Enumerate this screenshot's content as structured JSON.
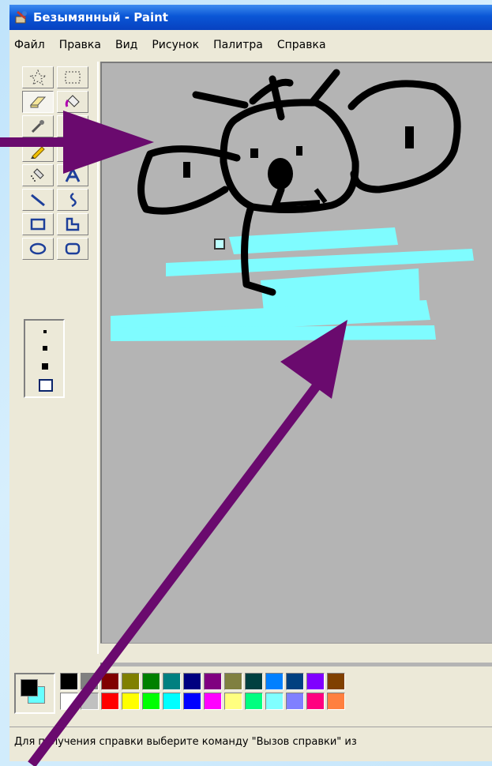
{
  "window": {
    "title": "Безымянный - Paint"
  },
  "menu": {
    "items": [
      "Файл",
      "Правка",
      "Вид",
      "Рисунок",
      "Палитра",
      "Справка"
    ]
  },
  "toolbox": {
    "tools": [
      {
        "name": "free-select",
        "icon": "star-select-icon"
      },
      {
        "name": "select",
        "icon": "rect-select-icon"
      },
      {
        "name": "eraser",
        "icon": "eraser-icon"
      },
      {
        "name": "fill",
        "icon": "fill-bucket-icon"
      },
      {
        "name": "pick-color",
        "icon": "eyedropper-icon"
      },
      {
        "name": "magnifier",
        "icon": "magnifier-icon"
      },
      {
        "name": "pencil",
        "icon": "pencil-icon"
      },
      {
        "name": "brush",
        "icon": "brush-icon"
      },
      {
        "name": "airbrush",
        "icon": "airbrush-icon"
      },
      {
        "name": "text",
        "icon": "text-A-icon"
      },
      {
        "name": "line",
        "icon": "line-icon"
      },
      {
        "name": "curve",
        "icon": "curve-icon"
      },
      {
        "name": "rectangle",
        "icon": "rectangle-icon"
      },
      {
        "name": "polygon",
        "icon": "polygon-icon"
      },
      {
        "name": "ellipse",
        "icon": "ellipse-icon"
      },
      {
        "name": "rounded-rect",
        "icon": "rounded-rect-icon"
      }
    ],
    "selected_tool": "eraser"
  },
  "colors": {
    "primary": "#000000",
    "secondary": "#66ffff",
    "palette_top": [
      "#000000",
      "#808080",
      "#800000",
      "#808000",
      "#008000",
      "#008080",
      "#000080",
      "#800080",
      "#808040",
      "#004040",
      "#0080ff",
      "#004080",
      "#8000ff",
      "#804000"
    ],
    "palette_bottom": [
      "#ffffff",
      "#c0c0c0",
      "#ff0000",
      "#ffff00",
      "#00ff00",
      "#00ffff",
      "#0000ff",
      "#ff00ff",
      "#ffff80",
      "#00ff80",
      "#80ffff",
      "#8080ff",
      "#ff0080",
      "#ff8040"
    ],
    "arrow": "#6a0a6e",
    "drawing_ink": "#000000",
    "drawing_fill": "#7ffcff"
  },
  "status": {
    "text": "Для получения справки выберите команду \"Вызов справки\" из"
  }
}
